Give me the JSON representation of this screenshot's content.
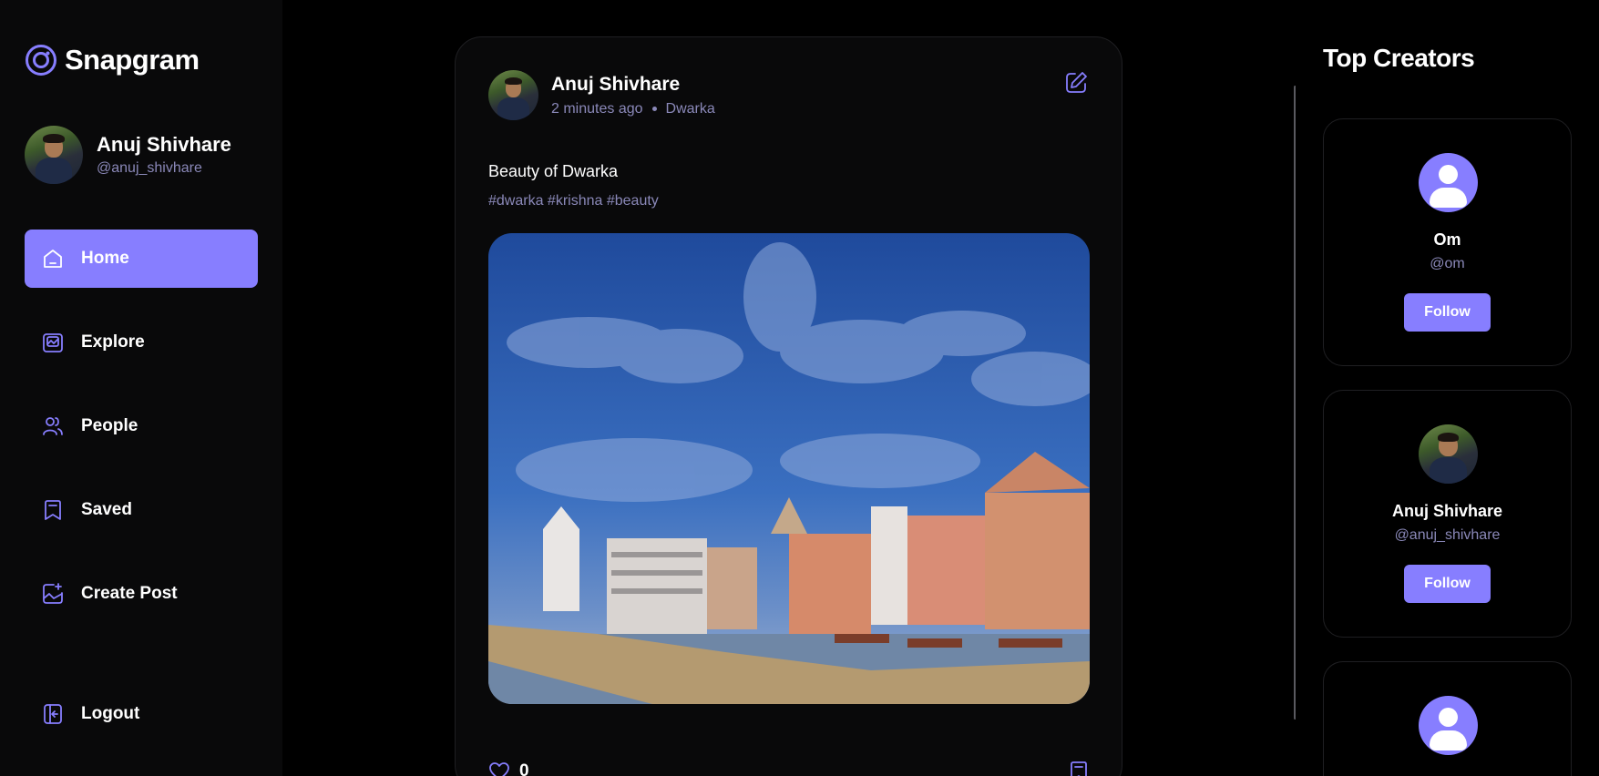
{
  "app": {
    "name": "Snapgram",
    "accent": "#877eff"
  },
  "user": {
    "name": "Anuj Shivhare",
    "handle": "@anuj_shivhare"
  },
  "sidebar": {
    "items": [
      {
        "label": "Home",
        "icon": "home-icon",
        "active": true
      },
      {
        "label": "Explore",
        "icon": "explore-icon",
        "active": false
      },
      {
        "label": "People",
        "icon": "people-icon",
        "active": false
      },
      {
        "label": "Saved",
        "icon": "bookmark-icon",
        "active": false
      },
      {
        "label": "Create Post",
        "icon": "create-post-icon",
        "active": false
      }
    ],
    "logout_label": "Logout"
  },
  "post": {
    "author": "Anuj Shivhare",
    "time": "2 minutes ago",
    "location": "Dwarka",
    "caption": "Beauty of Dwarka",
    "tags": "#dwarka #krishna #beauty",
    "likes": "0"
  },
  "right_panel": {
    "title": "Top Creators",
    "creators": [
      {
        "name": "Om",
        "handle": "@om",
        "follow_label": "Follow",
        "avatar": "default"
      },
      {
        "name": "Anuj Shivhare",
        "handle": "@anuj_shivhare",
        "follow_label": "Follow",
        "avatar": "photo"
      },
      {
        "name": "",
        "handle": "",
        "follow_label": "",
        "avatar": "default"
      }
    ]
  }
}
